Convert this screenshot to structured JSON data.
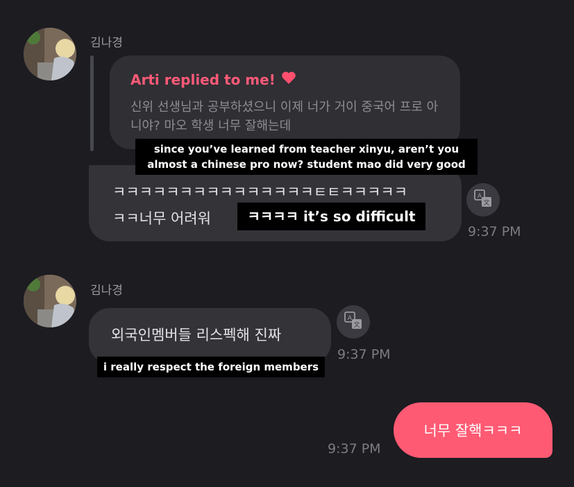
{
  "messages": {
    "group1": {
      "sender": "김나경",
      "reply": {
        "title": "Arti replied to me!",
        "quoted_text": "신위 선생님과 공부하셨으니 이제 너가 거이 중국어 프로 아니야? 마오 학생 너무 잘해는데"
      },
      "reply_caption": "since you’ve learned from teacher xinyu, aren’t you almost a chinese pro now? student mao did very good",
      "text_line1": "ㅋㅋㅋㅋㅋㅋㅋㅋㅋㅋㅋㅋㅋㅋㅋㅌㅌㅋㅋㅋㅋㅋ",
      "text_line2": "ㅋㅋ너무 어려워",
      "caption": "ㅋㅋㅋㅋ it’s so difficult",
      "time": "9:37 PM"
    },
    "group2": {
      "sender": "김나경",
      "text": "외국인멤버들 리스펙해 진짜",
      "caption": "i really respect the foreign members",
      "time": "9:37 PM"
    },
    "mine": {
      "text": "너무 잘핵ㅋㅋㅋ",
      "time": "9:37 PM"
    }
  },
  "colors": {
    "background": "#1c1c21",
    "incoming_bubble": "#333338",
    "outgoing_bubble": "#ff5a73",
    "accent": "#ff5a77"
  },
  "icons": {
    "translate": "translate-icon",
    "heart": "heart-icon",
    "avatar": "profile-photo"
  }
}
